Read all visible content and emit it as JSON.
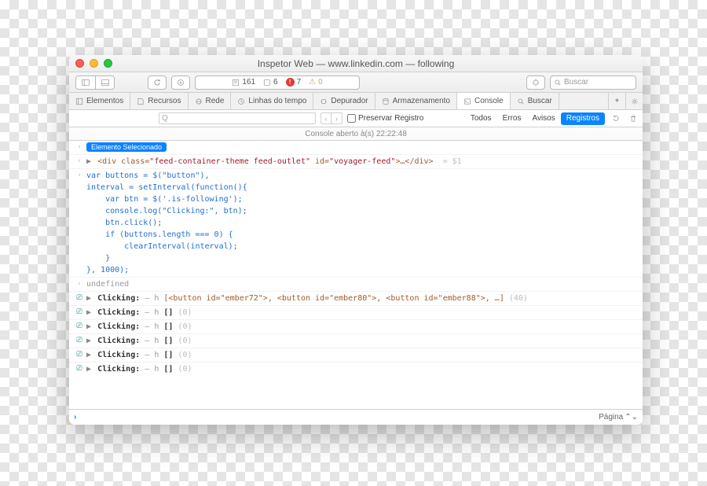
{
  "window_title": "Inspetor Web — www.linkedin.com — following",
  "url_stats": {
    "resources": "161",
    "issues": "6",
    "errors_count": "7",
    "warnings": "0"
  },
  "search_placeholder": "Buscar",
  "tabs": {
    "elementos": "Elementos",
    "recursos": "Recursos",
    "rede": "Rede",
    "linhas": "Linhas do tempo",
    "depurador": "Depurador",
    "armazenamento": "Armazenamento",
    "console": "Console",
    "buscar": "Buscar"
  },
  "filter": {
    "preserve": "Preservar Registro",
    "seg_all": "Todos",
    "seg_errors": "Erros",
    "seg_warnings": "Avisos",
    "seg_logs": "Registros"
  },
  "status_line": "Console aberto à(s) 22:22:48",
  "elem_badge": "Elemento Selecionado",
  "dollar1": "= $1",
  "div_html": {
    "open": "<div ",
    "cls_attr": "class=",
    "cls_val": "\"feed-container-theme feed-outlet\"",
    "id_attr": " id=",
    "id_val": "\"voyager-feed\"",
    "rest": ">…</div>"
  },
  "script_lines": [
    "var buttons = $(\"button\"),",
    "interval = setInterval(function(){",
    "    var btn = $('.is-following');",
    "    console.log(\"Clicking:\", btn);",
    "    btn.click();",
    "    if (buttons.length === 0) {",
    "        clearInterval(interval);",
    "    }",
    "}, 1000);"
  ],
  "undefined_label": "undefined",
  "click_prefix": "Clicking:",
  "click_mid": "– h",
  "click_first_rest": " [<button id=\"ember72\">, <button id=\"ember80\">, <button id=\"ember88\">, …] ",
  "click_first_count": "(40)",
  "click_empty_arr": " []",
  "click_empty_count": " (0)",
  "footer_page": "Página"
}
